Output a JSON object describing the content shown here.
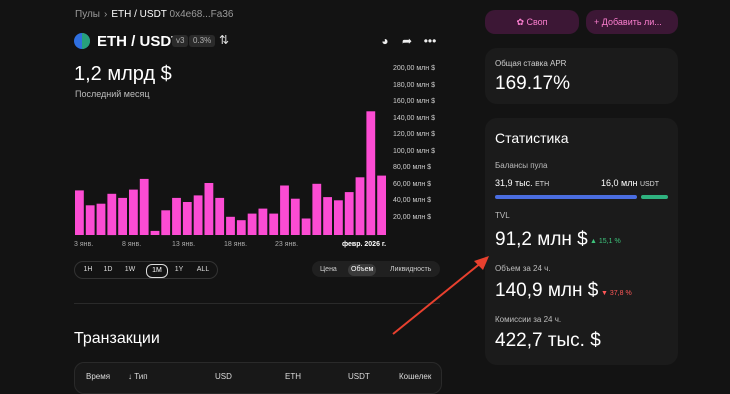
{
  "breadcrumb": {
    "pools": "Пулы",
    "pair": "ETH / USDT",
    "address": "0x4e68...Fa36"
  },
  "pool_header": {
    "title": "ETH / USDT",
    "version": "v3",
    "fee": "0.3%",
    "icons": [
      "swap-arrows-icon",
      "globe-icon",
      "share-icon",
      "more-icon"
    ]
  },
  "summary": {
    "value": "1,2 млрд $",
    "period": "Последний месяц"
  },
  "chart_data": {
    "type": "bar",
    "color": "#fc4cd3",
    "ylim": [
      0,
      200
    ],
    "y_ticks": [
      "200,00 млн $",
      "180,00 млн $",
      "160,00 млн $",
      "140,00 млн $",
      "120,00 млн $",
      "100,00 млн $",
      "80,00 млн $",
      "60,00 млн $",
      "40,00 млн $",
      "20,00 млн $"
    ],
    "x_ticks": [
      "3 янв.",
      "8 янв.",
      "13 янв.",
      "18 янв.",
      "23 янв.",
      "февр. 2026 г."
    ],
    "values": [
      54,
      36,
      38,
      50,
      45,
      55,
      68,
      5,
      30,
      45,
      40,
      48,
      63,
      45,
      22,
      18,
      26,
      32,
      26,
      60,
      44,
      20,
      62,
      46,
      42,
      52,
      70,
      150,
      72
    ]
  },
  "ranges": [
    "1H",
    "1D",
    "1W",
    "1M",
    "1Y",
    "ALL"
  ],
  "range_selected": "1M",
  "modes": [
    "Цена",
    "Объем",
    "Ликвидность"
  ],
  "mode_selected": "Объем",
  "actions": {
    "swap": "Своп",
    "add_liquidity": "+ Добавить ли..."
  },
  "apr": {
    "label": "Общая ставка APR",
    "value": "169.17%"
  },
  "stats": {
    "title": "Статистика",
    "balances_label": "Балансы пула",
    "eth_amount": "31,9 тыс.",
    "eth_symbol": "ETH",
    "usdt_amount": "16,0 млн",
    "usdt_symbol": "USDT",
    "eth_share": 0.83,
    "tvl_label": "TVL",
    "tvl_value": "91,2 млн $",
    "tvl_change": "15,1 %",
    "volume_label": "Объем за 24 ч.",
    "volume_value": "140,9 млн $",
    "volume_change": "37,8 %",
    "fees_label": "Комиссии за 24 ч.",
    "fees_value": "422,7 тыс. $"
  },
  "transactions": {
    "title": "Транзакции",
    "columns": [
      "Время",
      "Тип",
      "USD",
      "ETH",
      "USDT",
      "Кошелек"
    ]
  },
  "colors": {
    "accent": "#fc4cd3",
    "annotation_arrow": "#e8402e",
    "up": "#3ec47c",
    "down": "#ff5757"
  }
}
